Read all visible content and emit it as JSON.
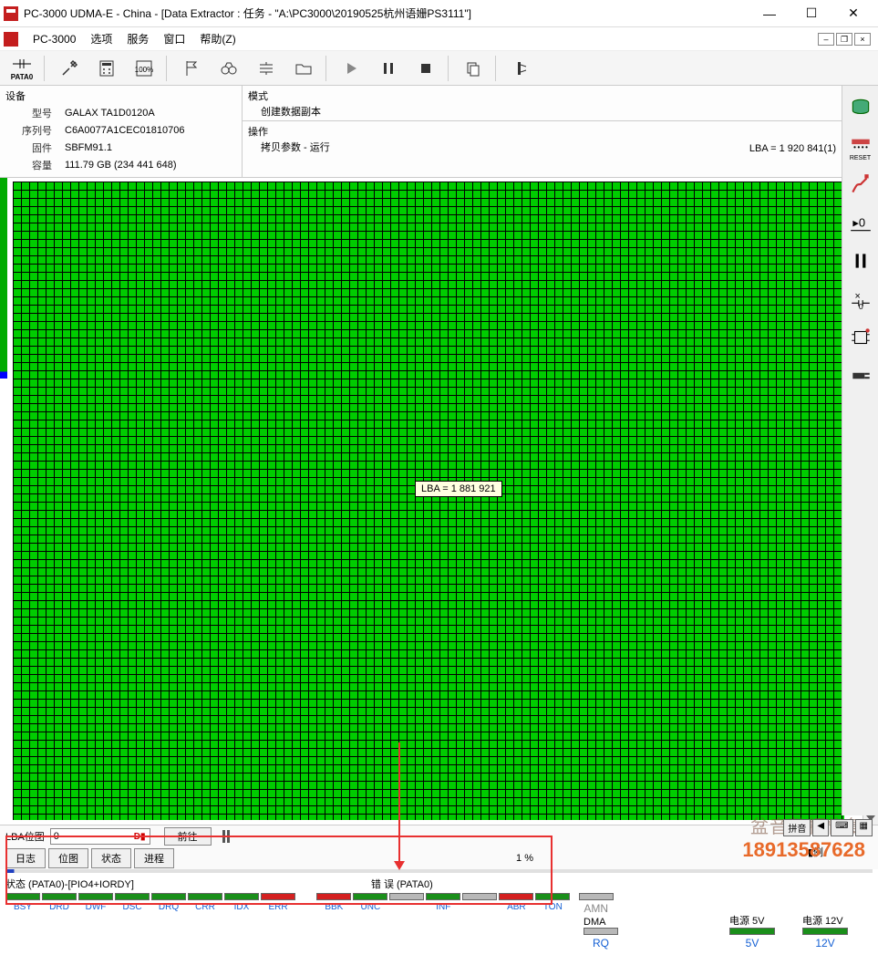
{
  "title": "PC-3000 UDMA-E - China - [Data Extractor : 任务 - \"A:\\PC3000\\20190525杭州语姗PS3111\"]",
  "menu": {
    "app": "PC-3000",
    "m1": "选项",
    "m2": "服务",
    "m3": "窗口",
    "m4": "帮助(Z)"
  },
  "device": {
    "hd": "设备",
    "model_l": "型号",
    "model": "GALAX TA1D0120A",
    "serial_l": "序列号",
    "serial": "C6A0077A1CEC01810706",
    "fw_l": "固件",
    "fw": "SBFM91.1",
    "cap_l": "容量",
    "cap": "111.79 GB (234 441 648)"
  },
  "mode": {
    "hd": "模式",
    "val": "创建数据副本"
  },
  "op": {
    "hd": "操作",
    "val": "拷贝参数 - 运行",
    "lba": "LBA =   1 920 841(1)"
  },
  "tooltip": "LBA =   1 881 921",
  "nav": {
    "label": "LBA位图",
    "val": "0",
    "btn": "前往",
    "dmarker": "D▮"
  },
  "tabs": {
    "t1": "日志",
    "t2": "位图",
    "t3": "状态",
    "t4": "进程",
    "pct": "1 %"
  },
  "status": {
    "hd1": "状态 (PATA0)-[PIO4+IORDY]",
    "hd2": "错 误 (PATA0)",
    "l": [
      "BSY",
      "DRD",
      "DWF",
      "DSC",
      "DRQ",
      "CRR",
      "IDX",
      "ERR"
    ],
    "e": [
      "BBK",
      "UNC",
      "",
      "INF",
      "",
      "ABR",
      "TON"
    ],
    "amn": "AMN",
    "dma": "DMA",
    "rq": "RQ",
    "p5l": "电源 5V",
    "p5": "5V",
    "p12l": "电源 12V",
    "p12": "12V"
  },
  "watermark": {
    "w1": "盆音数据恢复",
    "w2": "18913587628"
  },
  "legend": "▮例",
  "ime": "拼音",
  "right_labels": {
    "reset": "RESET"
  }
}
